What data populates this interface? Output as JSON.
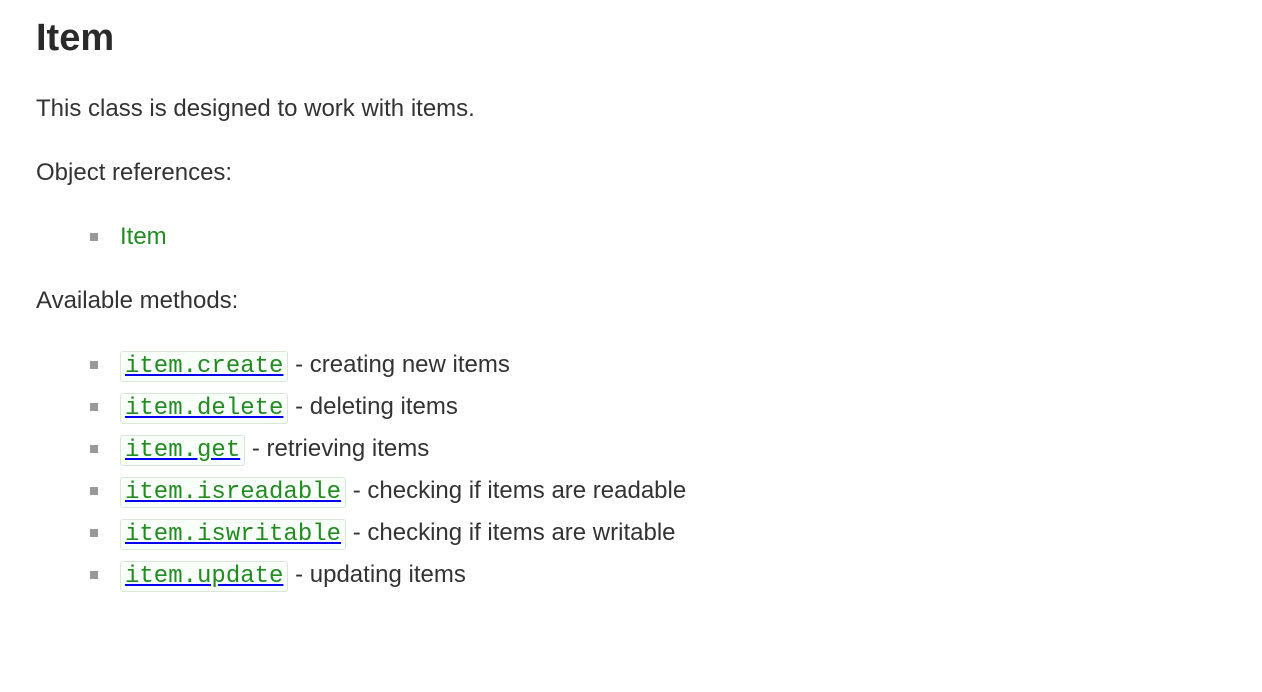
{
  "title": "Item",
  "intro": "This class is designed to work with items.",
  "references_label": "Object references:",
  "references": [
    {
      "label": "Item"
    }
  ],
  "methods_label": "Available methods:",
  "methods": [
    {
      "code": "item.create",
      "desc": " - creating new items"
    },
    {
      "code": "item.delete",
      "desc": " - deleting items"
    },
    {
      "code": "item.get",
      "desc": " - retrieving items"
    },
    {
      "code": "item.isreadable",
      "desc": " - checking if items are readable"
    },
    {
      "code": "item.iswritable",
      "desc": " - checking if items are writable"
    },
    {
      "code": "item.update",
      "desc": " - updating items"
    }
  ]
}
